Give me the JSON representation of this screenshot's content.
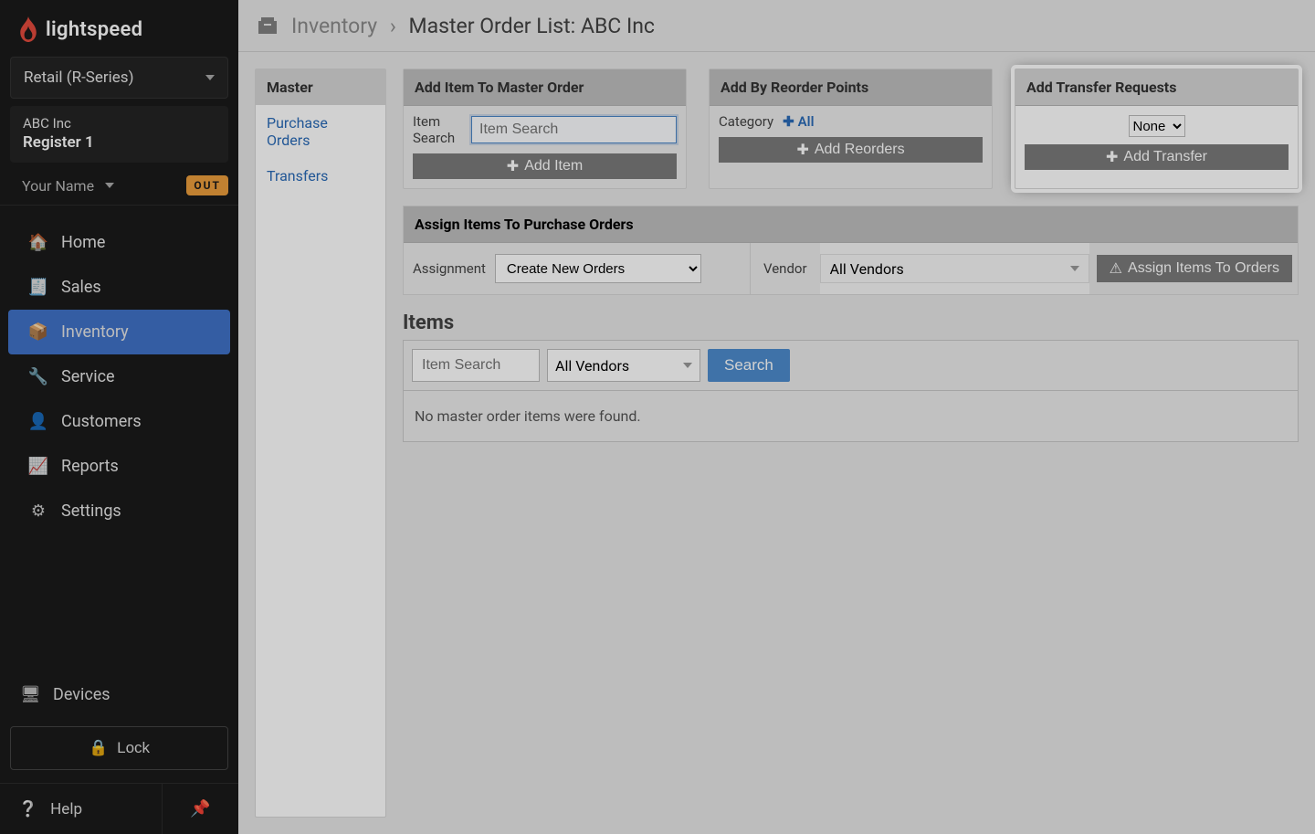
{
  "brand": "lightspeed",
  "product_selector": "Retail (R-Series)",
  "company": "ABC Inc",
  "register": "Register 1",
  "user_name": "Your Name",
  "out_badge": "OUT",
  "nav": [
    {
      "label": "Home"
    },
    {
      "label": "Sales"
    },
    {
      "label": "Inventory"
    },
    {
      "label": "Service"
    },
    {
      "label": "Customers"
    },
    {
      "label": "Reports"
    },
    {
      "label": "Settings"
    }
  ],
  "devices_label": "Devices",
  "lock_label": "Lock",
  "help_label": "Help",
  "breadcrumb": {
    "section": "Inventory",
    "page": "Master Order List:",
    "entity": "ABC Inc"
  },
  "left_tabs": {
    "active": "Master",
    "links": [
      "Purchase Orders",
      "Transfers"
    ]
  },
  "card_add_item": {
    "title": "Add Item To Master Order",
    "label": "Item Search",
    "placeholder": "Item Search",
    "button": "Add Item"
  },
  "card_reorder": {
    "title": "Add By Reorder Points",
    "label": "Category",
    "all": "All",
    "button": "Add Reorders"
  },
  "card_transfer": {
    "title": "Add Transfer Requests",
    "selected": "None",
    "button": "Add Transfer"
  },
  "assign": {
    "title": "Assign Items To Purchase Orders",
    "assignment_label": "Assignment",
    "assignment_value": "Create New Orders",
    "vendor_label": "Vendor",
    "vendor_value": "All Vendors",
    "button": "Assign Items To Orders"
  },
  "items": {
    "title": "Items",
    "search_placeholder": "Item Search",
    "vendor": "All Vendors",
    "search_button": "Search",
    "empty": "No master order items were found."
  }
}
